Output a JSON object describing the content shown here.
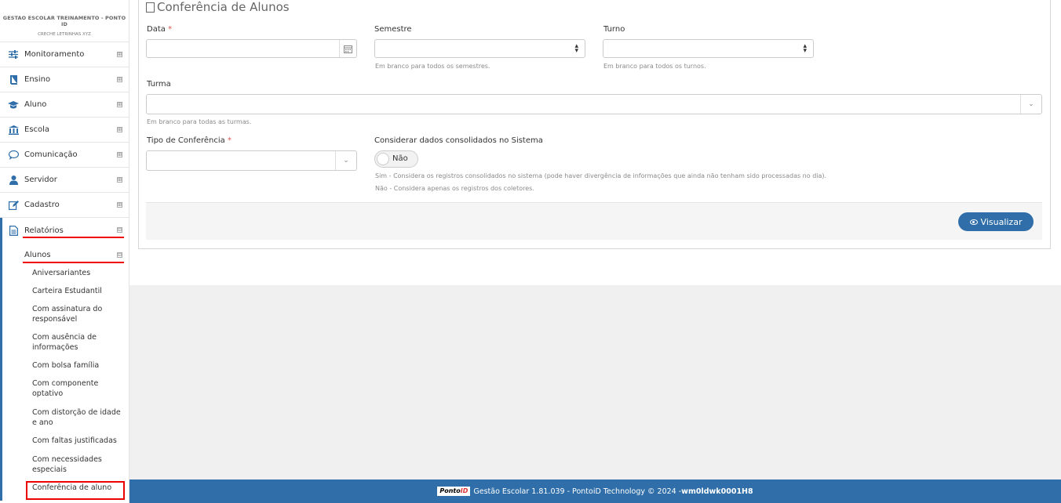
{
  "sidebar": {
    "org": "GESTAO ESCOLAR TREINAMENTO - PONTO ID",
    "school": "CRECHE LETRINHAS XYZ",
    "items": [
      {
        "label": "Monitoramento",
        "icon": "sliders-icon",
        "expand": "⊞"
      },
      {
        "label": "Ensino",
        "icon": "book-icon",
        "expand": "⊞"
      },
      {
        "label": "Aluno",
        "icon": "graduation-cap-icon",
        "expand": "⊞"
      },
      {
        "label": "Escola",
        "icon": "institution-icon",
        "expand": "⊞"
      },
      {
        "label": "Comunicação",
        "icon": "chat-bubble-icon",
        "expand": "⊞"
      },
      {
        "label": "Servidor",
        "icon": "user-icon",
        "expand": "⊞"
      },
      {
        "label": "Cadastro",
        "icon": "edit-icon",
        "expand": "⊞"
      },
      {
        "label": "Relatórios",
        "icon": "document-icon",
        "expand": "⊟"
      }
    ],
    "submenu": {
      "label": "Alunos",
      "expand": "⊟"
    },
    "leaves": [
      "Aniversariantes",
      "Carteira Estudantil",
      "Com assinatura do responsável",
      "Com ausência de informações",
      "Com bolsa família",
      "Com componente optativo",
      "Com distorção de idade e ano",
      "Com faltas justificadas",
      "Com necessidades especiais",
      "Conferência de aluno"
    ]
  },
  "form": {
    "title": "Conferência de Alunos",
    "data_label": "Data",
    "semestre_label": "Semestre",
    "semestre_help": "Em branco para todos os semestres.",
    "turno_label": "Turno",
    "turno_help": "Em branco para todos os turnos.",
    "turma_label": "Turma",
    "turma_help": "Em branco para todas as turmas.",
    "tipo_label": "Tipo de Conferência",
    "consolidados_label": "Considerar dados consolidados no Sistema",
    "toggle_value": "Não",
    "help_sim": "Sim - Considera os registros consolidados no sistema (pode haver divergência de informações que ainda não tenham sido processadas no dia).",
    "help_nao": "Não - Considera apenas os registros dos coletores.",
    "required_mark": "*",
    "submit": "Visualizar"
  },
  "footer": {
    "logo_text": "Ponto",
    "logo_id": "ID",
    "text": "Gestão Escolar 1.81.039 - PontoiD Technology © 2024 - ",
    "host": "wm0ldwk0001H8"
  }
}
